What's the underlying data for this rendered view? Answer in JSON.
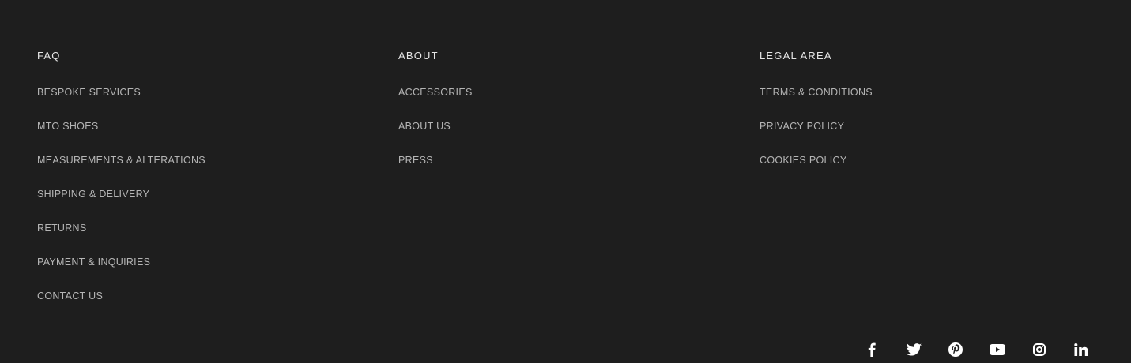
{
  "footer": {
    "columns": [
      {
        "heading": "FAQ",
        "links": [
          "BESPOKE SERVICES",
          "MTO SHOES",
          "MEASUREMENTS & ALTERATIONS",
          "SHIPPING & DELIVERY",
          "RETURNS",
          "PAYMENT & INQUIRIES",
          "CONTACT US"
        ]
      },
      {
        "heading": "ABOUT",
        "links": [
          "ACCESSORIES",
          "ABOUT US",
          "PRESS"
        ]
      },
      {
        "heading": "LEGAL AREA",
        "links": [
          "TERMS & CONDITIONS",
          "PRIVACY POLICY",
          "COOKIES POLICY"
        ]
      }
    ],
    "social": [
      {
        "icon": "facebook-icon"
      },
      {
        "icon": "twitter-icon"
      },
      {
        "icon": "pinterest-icon"
      },
      {
        "icon": "youtube-icon"
      },
      {
        "icon": "instagram-icon"
      },
      {
        "icon": "linkedin-icon"
      }
    ]
  },
  "colors": {
    "background": "#1e1e1e",
    "heading": "#e6e6e6",
    "link": "#b5b5b5",
    "icon": "#ffffff"
  }
}
